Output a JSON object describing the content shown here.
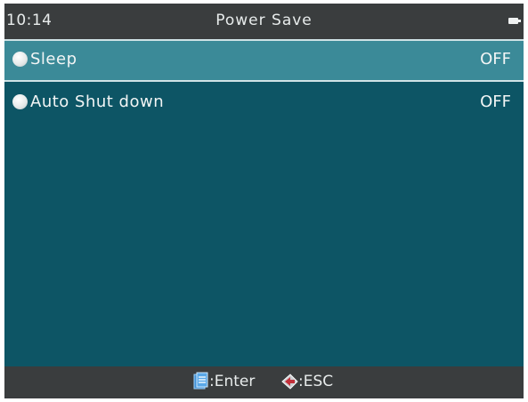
{
  "status_bar": {
    "time": "10:14",
    "title": "Power Save",
    "battery_icon": "battery-icon"
  },
  "menu": {
    "items": [
      {
        "label": "Sleep",
        "value": "OFF",
        "selected": true,
        "icon": "radio-icon"
      },
      {
        "label": "Auto Shut down",
        "value": "OFF",
        "selected": false,
        "icon": "radio-icon"
      }
    ]
  },
  "footer": {
    "enter_label": ":Enter",
    "esc_label": ":ESC",
    "enter_icon": "enter-key-icon",
    "esc_icon": "esc-key-icon"
  },
  "colors": {
    "background": "#0d5565",
    "bar": "#3a3d3e",
    "selected_row": "#3b8a98",
    "text": "#f2f5f5"
  }
}
